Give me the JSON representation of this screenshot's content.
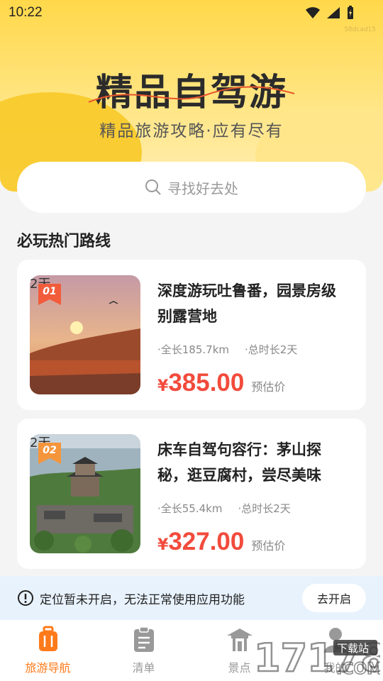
{
  "status_bar": {
    "time": "10:22"
  },
  "hero": {
    "title": "精品自驾游",
    "subtitle": "精品旅游攻略·应有尽有",
    "tag": "58dcad15"
  },
  "search": {
    "placeholder": "寻找好去处"
  },
  "section": {
    "title": "必玩热门路线"
  },
  "routes": [
    {
      "rank": "01",
      "days_overlay": "2天",
      "title": "深度游玩吐鲁番，园景房级别露营地",
      "distance": "·全长185.7km",
      "duration": "·总时长2天",
      "currency": "¥",
      "price": "385.00",
      "price_label": "预估价"
    },
    {
      "rank": "02",
      "days_overlay": "2天",
      "title": "床车自驾句容行：茅山探秘，逛豆腐村，尝尽美味",
      "distance": "·全长55.4km",
      "duration": "·总时长2天",
      "currency": "¥",
      "price": "327.00",
      "price_label": "预估价"
    }
  ],
  "notice": {
    "text": "定位暂未开启，无法正常使用应用功能",
    "button": "去开启"
  },
  "tabs": [
    {
      "label": "旅游导航",
      "icon": "suitcase-icon",
      "active": true
    },
    {
      "label": "清单",
      "icon": "clipboard-icon",
      "active": false
    },
    {
      "label": "景点",
      "icon": "pavilion-icon",
      "active": false
    },
    {
      "label": "我的",
      "icon": "person-icon",
      "active": false
    }
  ],
  "watermark": {
    "text": "17178",
    "sub": "下载站",
    "domain": ".COM"
  },
  "colors": {
    "accent": "#ff7a1a",
    "price": "#f24b3c",
    "hero": "#ffd84a",
    "notice_bg": "#e8f2fd"
  }
}
